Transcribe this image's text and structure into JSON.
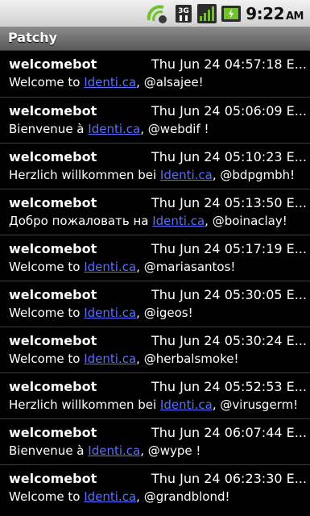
{
  "statusbar": {
    "time": "9:22",
    "ampm": "AM",
    "icons": [
      "sync-icon",
      "3g-icon",
      "signal-icon",
      "battery-icon"
    ]
  },
  "app": {
    "title": "Patchy"
  },
  "timeline": [
    {
      "author": "welcomebot",
      "date": "Thu Jun 24 04:57:18 E...",
      "prefix": "Welcome to ",
      "link": "Identi.ca",
      "suffix": ", @alsajee!"
    },
    {
      "author": "welcomebot",
      "date": "Thu Jun 24 05:06:09 E...",
      "prefix": "Bienvenue à ",
      "link": "Identi.ca",
      "suffix": ", @webdif !"
    },
    {
      "author": "welcomebot",
      "date": "Thu Jun 24 05:10:23 E...",
      "prefix": "Herzlich willkommen bei ",
      "link": "Identi.ca",
      "suffix": ", @bdpgmbh!"
    },
    {
      "author": "welcomebot",
      "date": "Thu Jun 24 05:13:50 E...",
      "prefix": "Добро пожаловать на ",
      "link": "Identi.ca",
      "suffix": ", @boinaclay!"
    },
    {
      "author": "welcomebot",
      "date": "Thu Jun 24 05:17:19 E...",
      "prefix": "Welcome to ",
      "link": "Identi.ca",
      "suffix": ", @mariasantos!"
    },
    {
      "author": "welcomebot",
      "date": "Thu Jun 24 05:30:05 E...",
      "prefix": "Welcome to ",
      "link": "Identi.ca",
      "suffix": ", @igeos!"
    },
    {
      "author": "welcomebot",
      "date": "Thu Jun 24 05:30:24 E...",
      "prefix": "Welcome to ",
      "link": "Identi.ca",
      "suffix": ", @herbalsmoke!"
    },
    {
      "author": "welcomebot",
      "date": "Thu Jun 24 05:52:53 E...",
      "prefix": "Herzlich willkommen bei ",
      "link": "Identi.ca",
      "suffix": ", @virusgerm!"
    },
    {
      "author": "welcomebot",
      "date": "Thu Jun 24 06:07:44 E...",
      "prefix": "Bienvenue à ",
      "link": "Identi.ca",
      "suffix": ", @wype !"
    },
    {
      "author": "welcomebot",
      "date": "Thu Jun 24 06:23:30 E...",
      "prefix": "Welcome to ",
      "link": "Identi.ca",
      "suffix": ", @grandblond!"
    }
  ]
}
